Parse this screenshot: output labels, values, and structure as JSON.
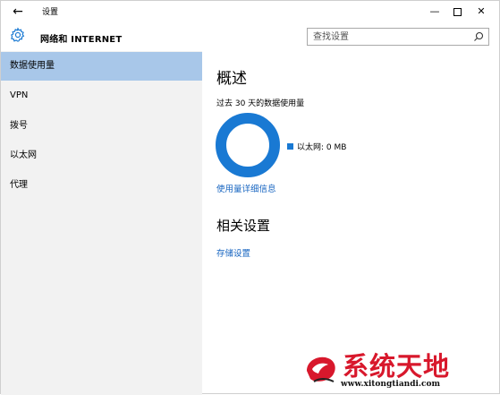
{
  "window": {
    "title": "设置",
    "controls": {
      "minimize": "—",
      "close": "✕"
    }
  },
  "header": {
    "app_title": "网络和 INTERNET",
    "search_placeholder": "查找设置"
  },
  "sidebar": {
    "items": [
      {
        "label": "数据使用量",
        "active": true
      },
      {
        "label": "VPN",
        "active": false
      },
      {
        "label": "拨号",
        "active": false
      },
      {
        "label": "以太网",
        "active": false
      },
      {
        "label": "代理",
        "active": false
      }
    ]
  },
  "main": {
    "overview_title": "概述",
    "usage_period": "过去 30 天的数据使用量",
    "legend": {
      "label": "以太网: 0 MB",
      "color": "#1979d3"
    },
    "details_link": "使用量详细信息",
    "related_title": "相关设置",
    "storage_link": "存储设置"
  },
  "watermark": {
    "brand": "系统天地",
    "url": "www.xitongtiandi.com"
  },
  "colors": {
    "accent": "#1979d3",
    "link": "#1664c0",
    "sidebar_bg": "#f2f2f2",
    "sidebar_active": "#a8c7e9",
    "watermark_red": "#d8182c"
  }
}
